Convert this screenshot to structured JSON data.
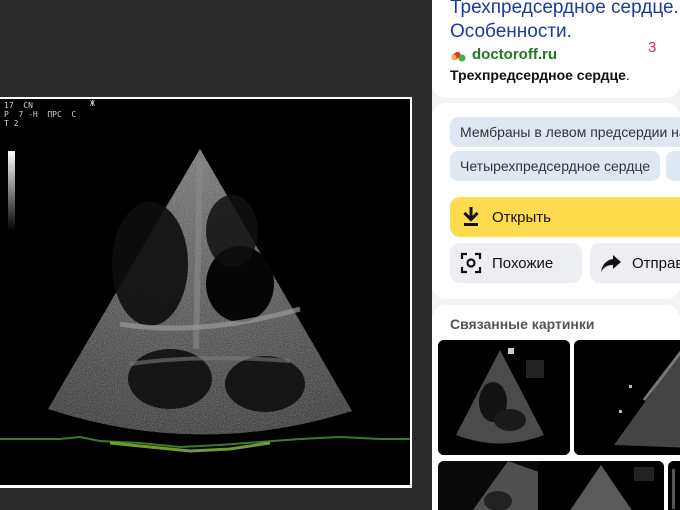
{
  "viewer": {
    "overlay_left": "17  CN\nP  7 -H  ПРС  С\nТ 2",
    "overlay_top": "Ж"
  },
  "result": {
    "title_line1": "Трехпредсердное сердце.",
    "title_line2": "Особенности.",
    "counter": "3",
    "site": "doctoroff.ru",
    "subtitle": "Трехпредсердное сердце",
    "subtitle_dot": "."
  },
  "tags": [
    "Мембраны в левом предсердии на",
    "Четырехпредсердное сердце"
  ],
  "actions": {
    "open_label": "Открыть",
    "similar_label": "Похожие",
    "share_label": "Отправ"
  },
  "related": {
    "title": "Связанные картинки"
  },
  "colors": {
    "title": "#1a3c9e",
    "site": "#1f7a1f",
    "open_button": "#ffdb4d",
    "chip_bg": "#dfe7f3"
  }
}
